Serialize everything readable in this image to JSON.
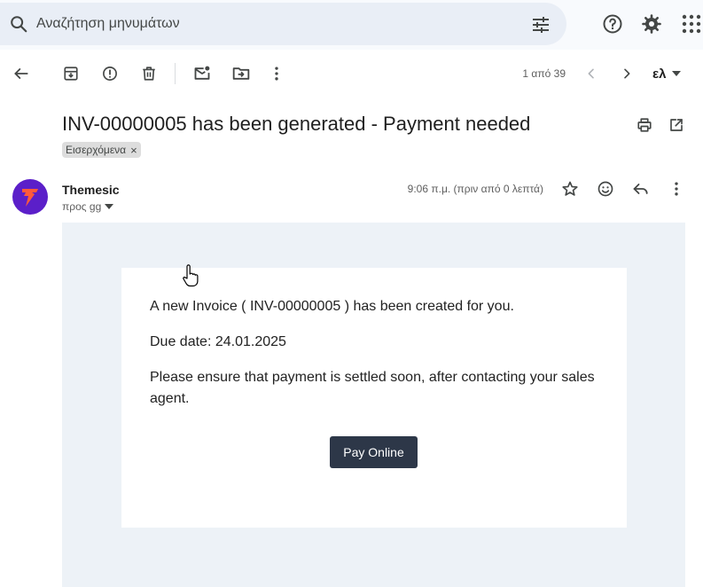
{
  "search": {
    "placeholder": "Αναζήτηση μηνυμάτων"
  },
  "toolbar": {
    "pager": "1 από 39",
    "language": "ελ"
  },
  "email": {
    "subject": "INV-00000005 has been generated - Payment needed",
    "label": "Εισερχόμενα",
    "label_remove": "×",
    "sender": "Themesic",
    "recipient": "προς gg",
    "time": "9:06 π.μ. (πριν από 0 λεπτά)",
    "body": {
      "line1": "A new Invoice ( INV-00000005 ) has been created for you.",
      "line2": "Due date: 24.01.2025",
      "line3": "Please ensure that payment is settled soon, after contacting your sales agent.",
      "button": "Pay Online"
    }
  },
  "colors": {
    "email_background": "#edf2f7",
    "button": "#2d3748",
    "avatar": "#5b1fc9",
    "avatar_bolt": "#ff5a3c"
  }
}
